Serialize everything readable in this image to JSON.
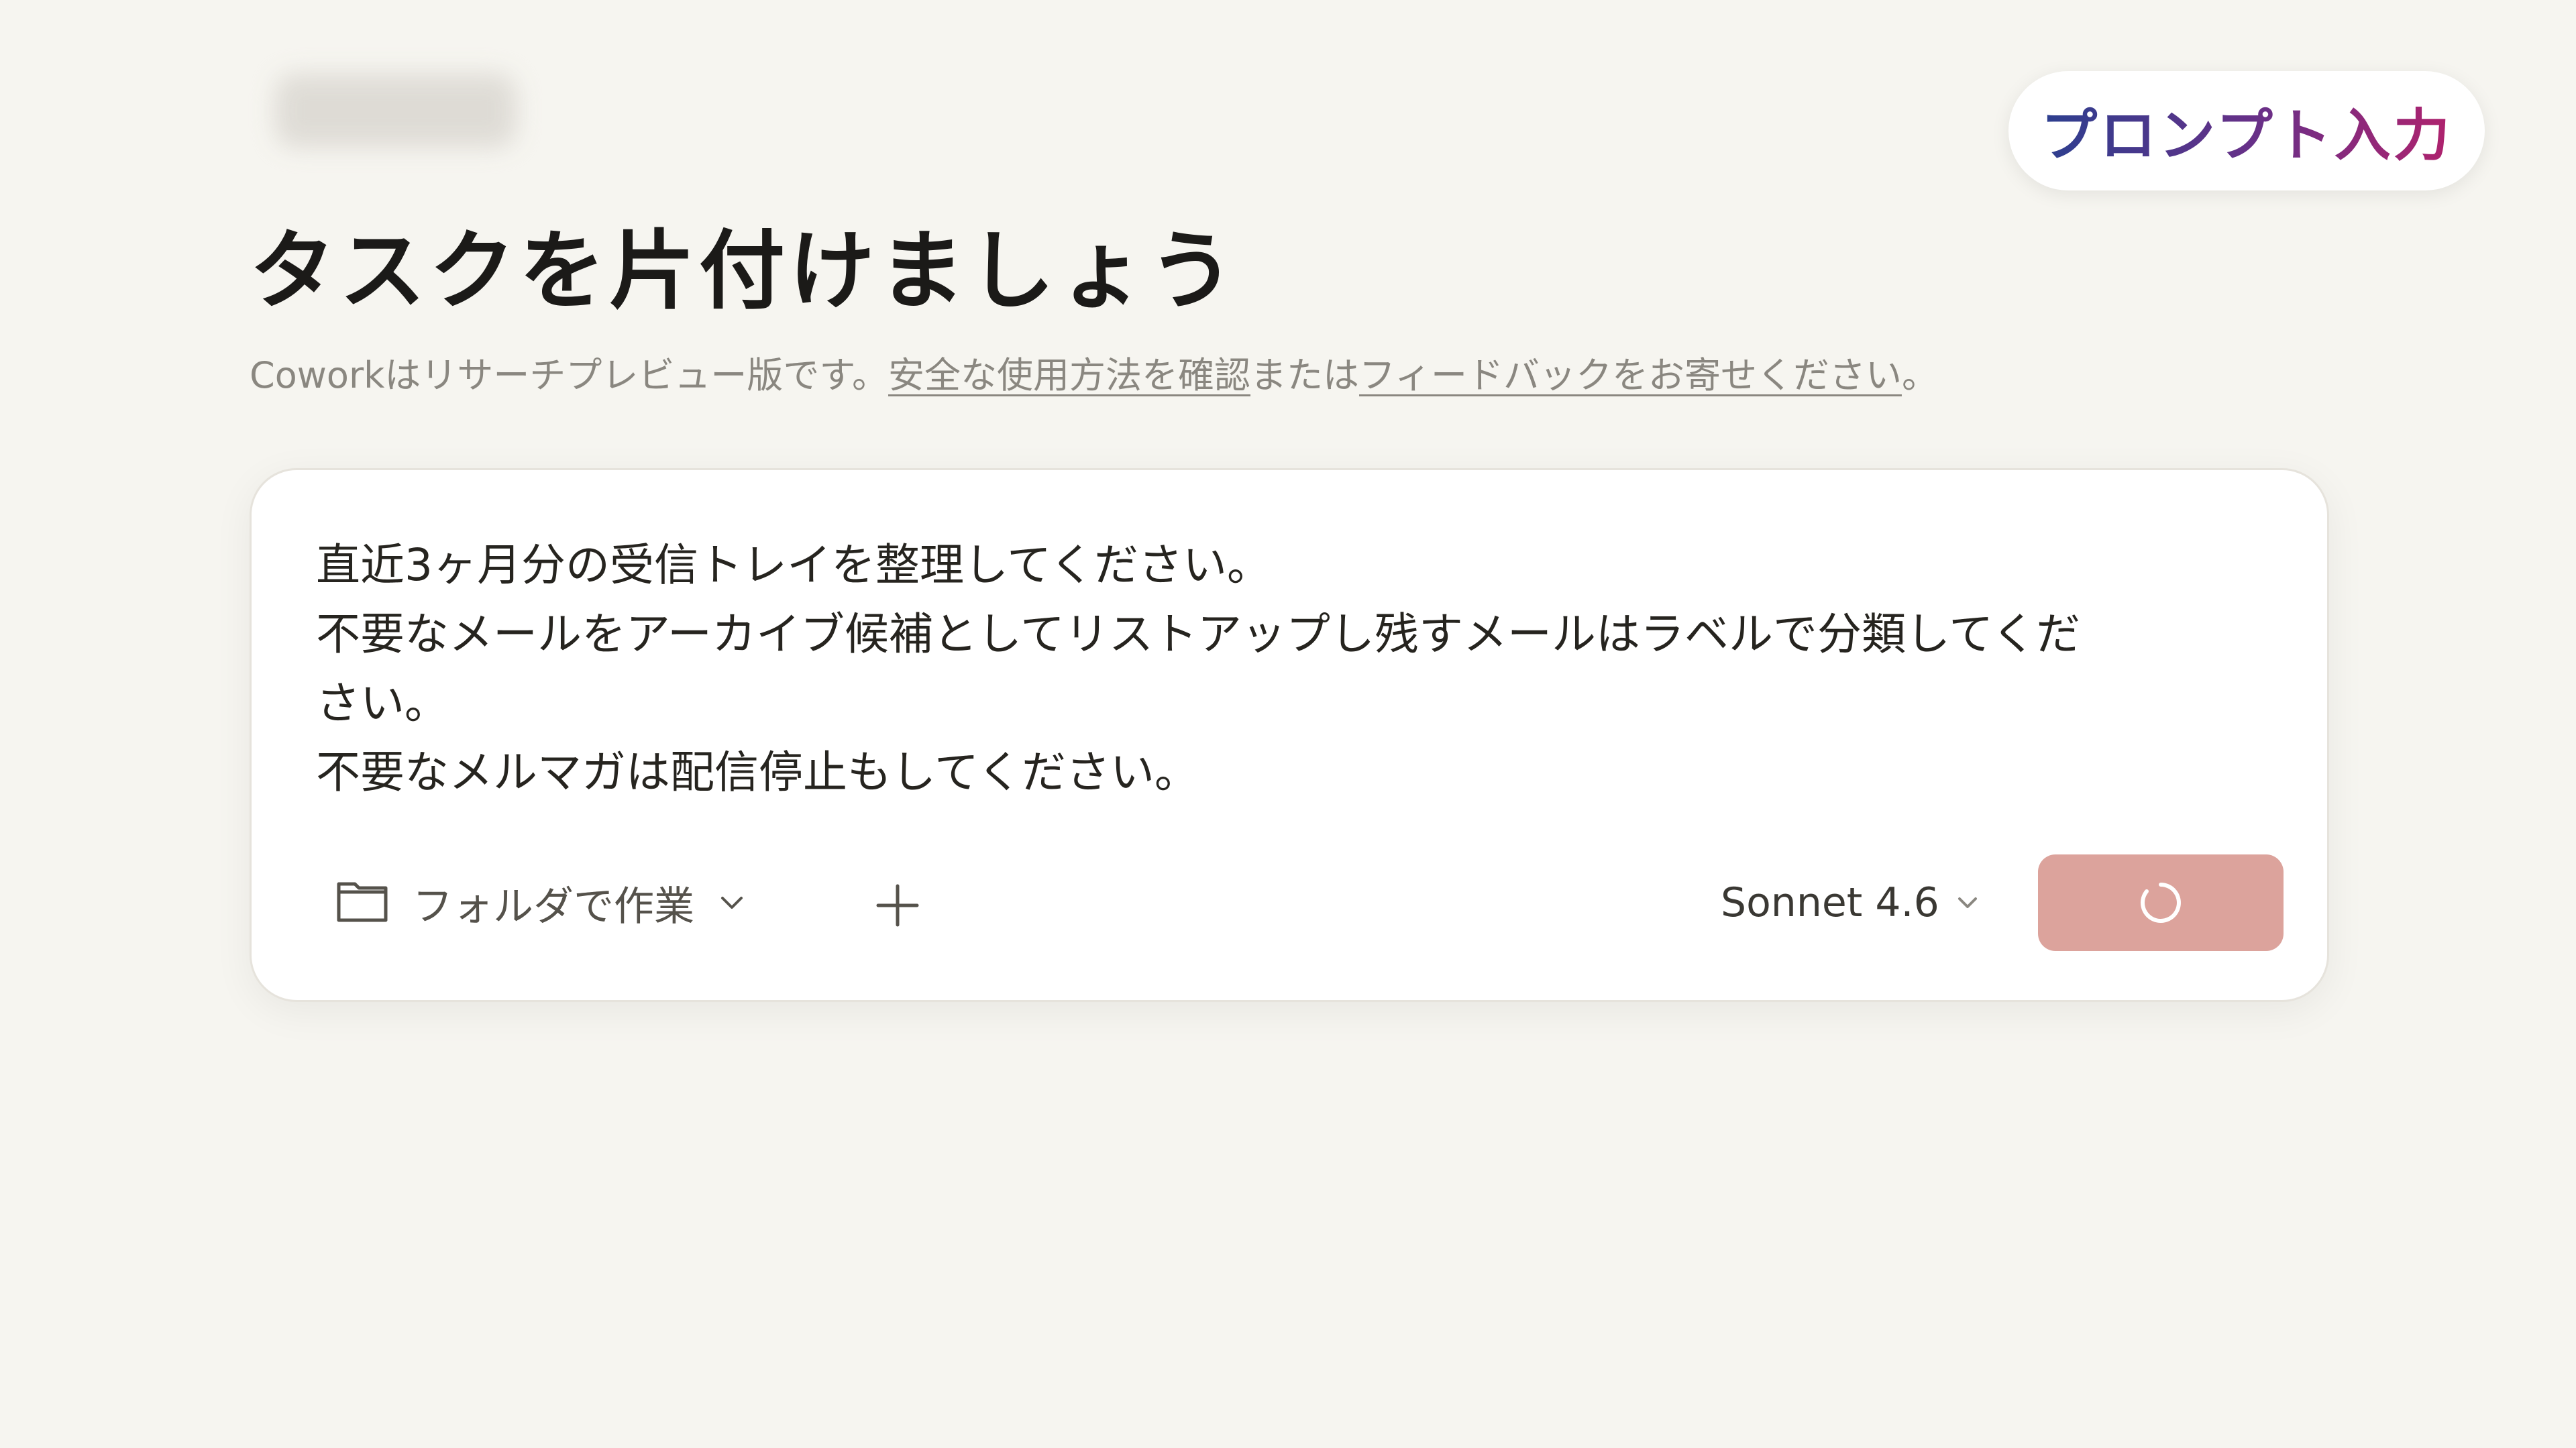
{
  "badge": {
    "label": "プロンプト入力"
  },
  "header": {
    "title": "タスクを片付けましょう",
    "subtitle_prefix": "Coworkはリサーチプレビュー版です。",
    "safety_link": "安全な使用方法を確認",
    "subtitle_middle": "または",
    "feedback_link": "フィードバックをお寄せください",
    "subtitle_suffix": "。"
  },
  "composer": {
    "prompt_lines": [
      "直近3ヶ月分の受信トレイを整理してください。",
      "不要なメールをアーカイブ候補としてリストアップし残すメールはラベルで分類してくだ",
      "さい。",
      "不要なメルマガは配信停止もしてください。"
    ],
    "folder_label": "フォルダで作業",
    "model_label": "Sonnet 4.6",
    "send_state": "loading"
  },
  "colors": {
    "background": "#f6f5f0",
    "send_button": "#dca39c",
    "badge_gradient_start": "#2c3f8f",
    "badge_gradient_end": "#b0226d"
  },
  "icons": {
    "folder": "folder-icon",
    "folder_chevron": "chevron-down-icon",
    "add": "plus-icon",
    "model_chevron": "chevron-down-icon",
    "send": "loading-spinner-icon"
  }
}
